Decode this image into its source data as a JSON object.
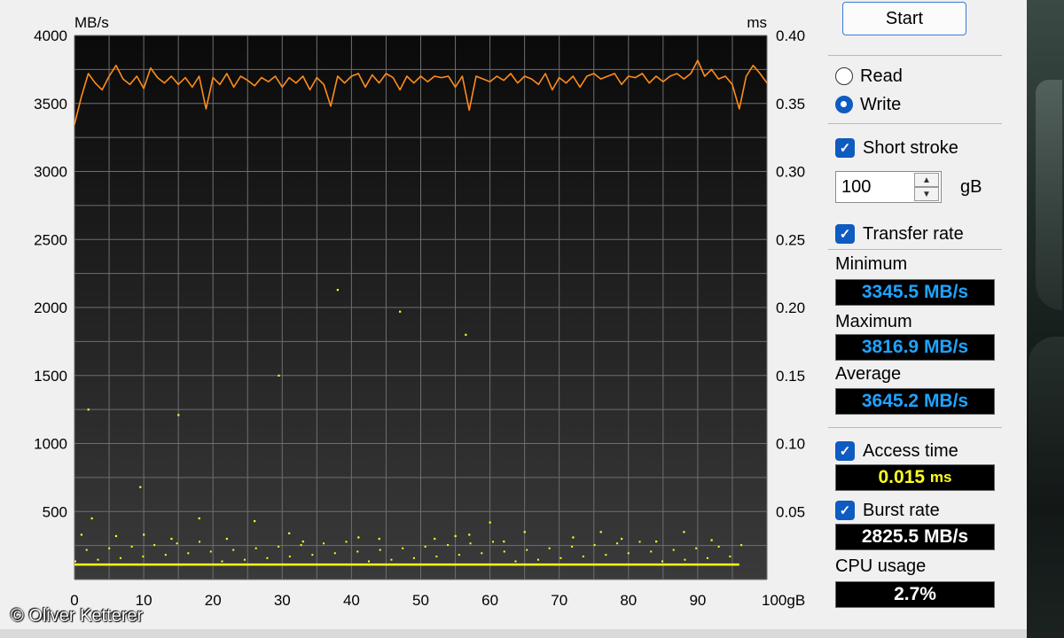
{
  "chart_data": {
    "type": "line",
    "y_left_label": "MB/s",
    "y_right_label": "ms",
    "x_unit": "gB",
    "xlim": [
      0,
      100
    ],
    "ylim_left": [
      0,
      4000
    ],
    "ylim_right": [
      0,
      0.4
    ],
    "x_ticks": [
      "0",
      "10",
      "20",
      "30",
      "40",
      "50",
      "60",
      "70",
      "80",
      "90",
      "100gB"
    ],
    "y_left_ticks": [
      "4000",
      "3500",
      "3000",
      "2500",
      "2000",
      "1500",
      "1000",
      "500"
    ],
    "y_right_ticks": [
      "0.40",
      "0.35",
      "0.30",
      "0.25",
      "0.20",
      "0.15",
      "0.10",
      "0.05"
    ],
    "grid": true,
    "series": [
      {
        "color": "#ff8c1a",
        "x": [
          0,
          1,
          2,
          3,
          4,
          5,
          6,
          7,
          8,
          9,
          10,
          11,
          12,
          13,
          14,
          15,
          16,
          17,
          18,
          19,
          20,
          21,
          22,
          23,
          24,
          25,
          26,
          27,
          28,
          29,
          30,
          31,
          32,
          33,
          34,
          35,
          36,
          37,
          38,
          39,
          40,
          41,
          42,
          43,
          44,
          45,
          46,
          47,
          48,
          49,
          50,
          51,
          52,
          53,
          54,
          55,
          56,
          57,
          58,
          59,
          60,
          61,
          62,
          63,
          64,
          65,
          66,
          67,
          68,
          69,
          70,
          71,
          72,
          73,
          74,
          75,
          76,
          77,
          78,
          79,
          80,
          81,
          82,
          83,
          84,
          85,
          86,
          87,
          88,
          89,
          90,
          91,
          92,
          93,
          94,
          95,
          96,
          97,
          98,
          99,
          100
        ],
        "y": [
          3345,
          3550,
          3720,
          3650,
          3600,
          3700,
          3780,
          3680,
          3640,
          3700,
          3610,
          3760,
          3690,
          3650,
          3700,
          3640,
          3690,
          3620,
          3700,
          3460,
          3690,
          3640,
          3720,
          3620,
          3700,
          3670,
          3630,
          3690,
          3660,
          3700,
          3620,
          3690,
          3650,
          3700,
          3600,
          3690,
          3640,
          3480,
          3700,
          3650,
          3700,
          3720,
          3620,
          3710,
          3650,
          3720,
          3690,
          3600,
          3700,
          3650,
          3700,
          3660,
          3700,
          3690,
          3700,
          3620,
          3700,
          3450,
          3700,
          3680,
          3660,
          3700,
          3670,
          3720,
          3650,
          3700,
          3680,
          3640,
          3720,
          3600,
          3690,
          3650,
          3700,
          3620,
          3700,
          3720,
          3680,
          3700,
          3720,
          3640,
          3700,
          3690,
          3720,
          3650,
          3700,
          3660,
          3700,
          3720,
          3680,
          3720,
          3817,
          3700,
          3750,
          3680,
          3700,
          3640,
          3460,
          3700,
          3780,
          3720,
          3650
        ]
      }
    ],
    "access_points": {
      "color": "#ffff22",
      "baseline_ms": 0.011,
      "outliers": [
        [
          2,
          0.125
        ],
        [
          2.5,
          0.045
        ],
        [
          9.5,
          0.068
        ],
        [
          15,
          0.121
        ],
        [
          18,
          0.045
        ],
        [
          26,
          0.043
        ],
        [
          29.5,
          0.15
        ],
        [
          38,
          0.213
        ],
        [
          47,
          0.197
        ],
        [
          56.5,
          0.18
        ],
        [
          60,
          0.042
        ],
        [
          57,
          0.033
        ],
        [
          65,
          0.035
        ],
        [
          76,
          0.035
        ],
        [
          88,
          0.035
        ],
        [
          1,
          0.033
        ],
        [
          6,
          0.032
        ],
        [
          10,
          0.033
        ],
        [
          14,
          0.03
        ],
        [
          22,
          0.03
        ],
        [
          31,
          0.034
        ],
        [
          33,
          0.028
        ],
        [
          41,
          0.031
        ],
        [
          44,
          0.03
        ],
        [
          52,
          0.03
        ],
        [
          55,
          0.032
        ],
        [
          62,
          0.028
        ],
        [
          72,
          0.031
        ],
        [
          79,
          0.03
        ],
        [
          84,
          0.028
        ],
        [
          92,
          0.029
        ]
      ]
    }
  },
  "controls": {
    "start_label": "Start",
    "read_label": "Read",
    "write_label": "Write",
    "mode_selected": "Write",
    "short_stroke_label": "Short stroke",
    "short_stroke_checked": true,
    "size_value": "100",
    "size_unit": "gB",
    "transfer_rate_label": "Transfer rate",
    "transfer_rate_checked": true,
    "access_time_label": "Access time",
    "access_time_checked": true,
    "burst_rate_label": "Burst rate",
    "burst_rate_checked": true
  },
  "stats": {
    "minimum_label": "Minimum",
    "minimum_value": "3345.5 MB/s",
    "maximum_label": "Maximum",
    "maximum_value": "3816.9 MB/s",
    "average_label": "Average",
    "average_value": "3645.2 MB/s",
    "access_time_num": "0.015",
    "access_time_unit": "ms",
    "burst_rate_value": "2825.5 MB/s",
    "cpu_usage_label": "CPU usage",
    "cpu_usage_value": "2.7%"
  },
  "watermark": "© Oliver Ketterer",
  "colors": {
    "plot_top": "#0a0a0a",
    "plot_bottom": "#3a3a3a",
    "grid": "#6e6e6e",
    "transfer_line": "#ff8c1a",
    "access_dots": "#ffff22",
    "readout_blue": "#1fa3ff",
    "accent": "#0e5bc2"
  }
}
